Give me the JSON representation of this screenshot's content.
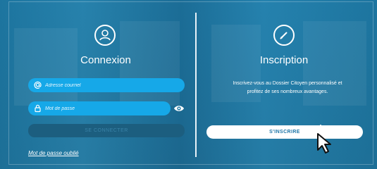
{
  "login": {
    "title": "Connexion",
    "email_placeholder": "Adresse courriel",
    "password_placeholder": "Mot de passe",
    "submit_label": "SE CONNECTER",
    "forgot_label": "Mot de passe oublié"
  },
  "signup": {
    "title": "Inscription",
    "description": "Inscrivez-vous au Dossier Citoyen personnalisé et profitez de ses nombreux avantages.",
    "button_label": "S'INSCRIRE"
  },
  "icons": {
    "login": "user-icon",
    "signup": "pencil-icon",
    "email": "at-icon",
    "password": "lock-icon",
    "reveal": "eye-icon",
    "cursor": "cursor-pointer-icon"
  },
  "colors": {
    "field": "#16a8e8",
    "button_dark": "#1c5e7f",
    "button_light": "#ffffff",
    "accent_text": "#1d76a8"
  }
}
